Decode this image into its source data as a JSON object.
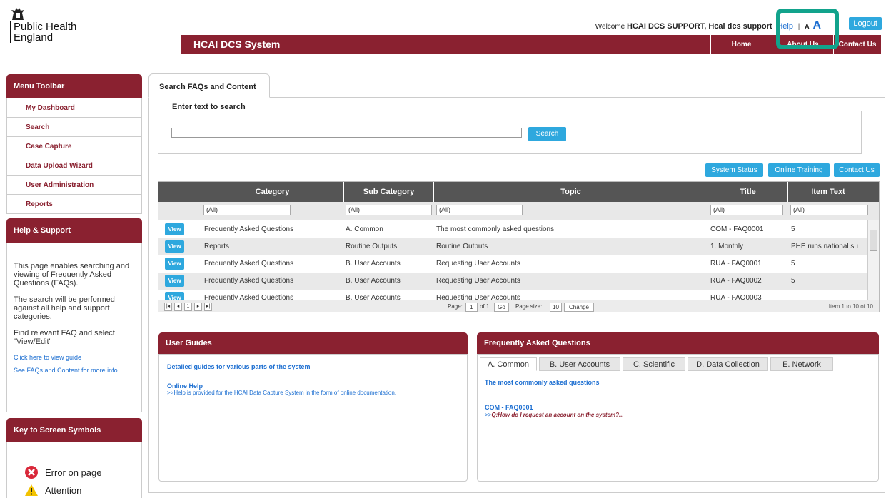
{
  "org": {
    "name_line1": "Public Health",
    "name_line2": "England"
  },
  "user": {
    "welcome_prefix": "Welcome",
    "welcome_name": "HCAI DCS SUPPORT, Hcai dcs support",
    "help_link": "Help",
    "separator": "|",
    "font_small": "A",
    "font_large": "A",
    "logout_label": "Logout"
  },
  "topbar": {
    "title": "HCAI DCS System",
    "nav": [
      "Home",
      "About Us",
      "Contact Us"
    ]
  },
  "sidebar": {
    "menu_title": "Menu Toolbar",
    "menu_items": [
      "My Dashboard",
      "Search",
      "Case Capture",
      "Data Upload Wizard",
      "User Administration",
      "Reports"
    ],
    "help_title": "Help & Support",
    "help_paragraphs": [
      "This page enables searching and viewing of Frequently Asked Questions (FAQs).",
      "The search will be performed against all help and support categories.",
      "Find relevant FAQ and select \"View/Edit\""
    ],
    "help_links": [
      "Click here to view guide",
      "See FAQs and Content for more info"
    ],
    "key_title": "Key to Screen Symbols",
    "key_items": [
      "Error on page",
      "Attention"
    ]
  },
  "main": {
    "tab_label": "Search FAQs and Content",
    "search_legend": "Enter text to search",
    "search_value": "",
    "search_button": "Search",
    "action_buttons": [
      "System Status",
      "Online Training",
      "Contact Us"
    ]
  },
  "grid": {
    "columns": [
      "Category",
      "Sub Category",
      "Topic",
      "Title",
      "Item Text"
    ],
    "filter_value": "(All)",
    "view_label": "View",
    "rows": [
      [
        "Frequently Asked Questions",
        "A. Common",
        "The most commonly asked questions",
        "COM - FAQ0001",
        "5"
      ],
      [
        "Reports",
        "Routine Outputs",
        "Routine Outputs",
        "1. Monthly",
        "PHE runs national su"
      ],
      [
        "Frequently Asked Questions",
        "B. User Accounts",
        "Requesting User Accounts",
        "RUA - FAQ0001",
        "5"
      ],
      [
        "Frequently Asked Questions",
        "B. User Accounts",
        "Requesting User Accounts",
        "RUA - FAQ0002",
        "5"
      ],
      [
        "Frequently Asked Questions",
        "B. User Accounts",
        "Requesting User Accounts",
        "RUA - FAQ0003",
        ""
      ]
    ],
    "pager": {
      "current_page": "1",
      "page_label": "Page:",
      "page_value": "1",
      "of_label": "of 1",
      "go_label": "Go",
      "size_label": "Page size:",
      "size_value": "10",
      "change_label": "Change",
      "summary": "Item 1 to 10 of 10"
    }
  },
  "user_guides": {
    "title": "User Guides",
    "intro": "Detailed guides for various parts of the system",
    "link_title": "Online Help",
    "link_desc": ">>Help is provided for the HCAI Data Capture System in the form of online documentation."
  },
  "faq": {
    "title": "Frequently Asked Questions",
    "tabs": [
      "A. Common",
      "B. User Accounts",
      "C. Scientific",
      "D. Data Collection",
      "E. Network"
    ],
    "active_tab": 0,
    "heading": "The most commonly asked questions",
    "item_title": "COM - FAQ0001",
    "item_prefix": ">>",
    "item_question": "Q:How do I request an account on the system?..."
  },
  "colors": {
    "brand": "#8a2130",
    "accent": "#2ea8de",
    "link": "#1d6fd1",
    "highlight": "#12a38c"
  }
}
